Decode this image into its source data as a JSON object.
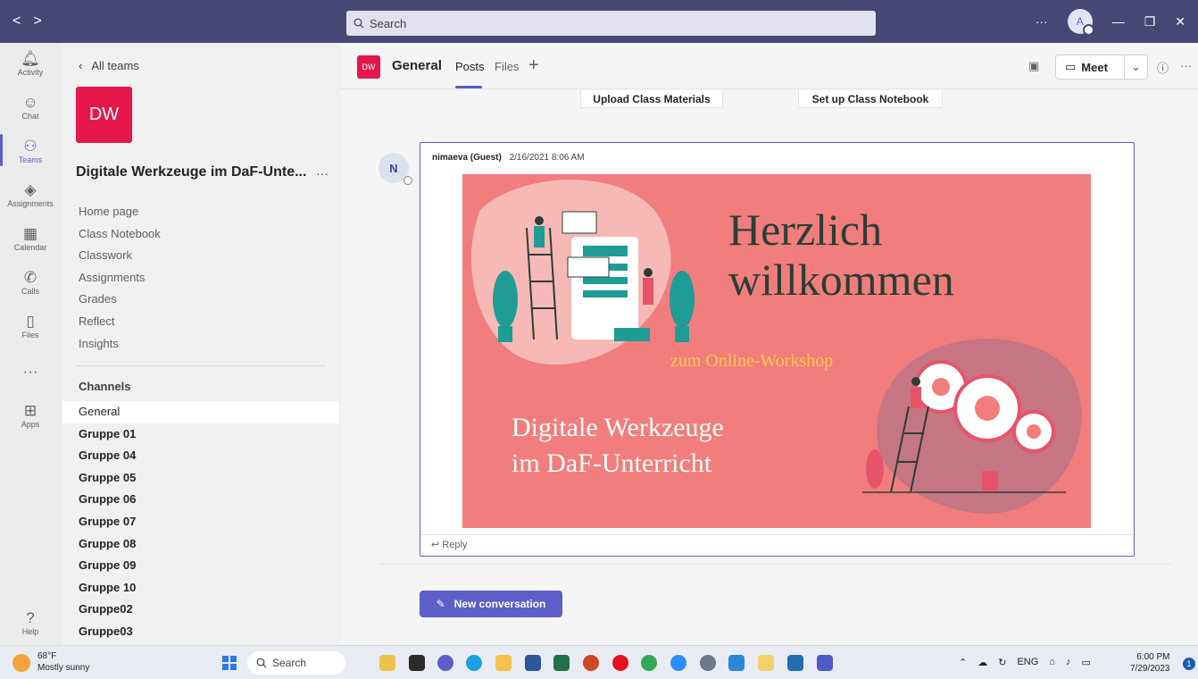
{
  "titlebar": {
    "back": "<",
    "forward": ">",
    "search_placeholder": "Search",
    "more": "···",
    "avatar_initials": "A",
    "min": "—",
    "max": "❐",
    "close": "✕"
  },
  "rail": [
    {
      "label": "Activity",
      "icon": "bell-icon",
      "glyph": "🔔︎"
    },
    {
      "label": "Chat",
      "icon": "chat-icon",
      "glyph": "☺"
    },
    {
      "label": "Teams",
      "icon": "teams-icon",
      "glyph": "⚇"
    },
    {
      "label": "Assignments",
      "icon": "assignments-icon",
      "glyph": "◈"
    },
    {
      "label": "Calendar",
      "icon": "calendar-icon",
      "glyph": "▦"
    },
    {
      "label": "Calls",
      "icon": "phone-icon",
      "glyph": "✆"
    },
    {
      "label": "Files",
      "icon": "file-icon",
      "glyph": "▯"
    },
    {
      "label": "",
      "icon": "more-icon",
      "glyph": "···"
    },
    {
      "label": "Apps",
      "icon": "apps-icon",
      "glyph": "⊞"
    },
    {
      "label": "Help",
      "icon": "help-icon",
      "glyph": "?"
    }
  ],
  "teampanel": {
    "back_label": "All teams",
    "logo_text": "DW",
    "team_name": "Digitale Werkzeuge im DaF-Unte...",
    "more": "···",
    "nav": [
      "Home page",
      "Class Notebook",
      "Classwork",
      "Assignments",
      "Grades",
      "Reflect",
      "Insights"
    ],
    "channels_heading": "Channels",
    "channels": [
      "General",
      "Gruppe 01",
      "Gruppe 04",
      "Gruppe 05",
      "Gruppe 06",
      "Gruppe 07",
      "Gruppe 08",
      "Gruppe 09",
      "Gruppe 10",
      "Gruppe02",
      "Gruppe03"
    ]
  },
  "channel_header": {
    "logo_text": "DW",
    "title": "General",
    "tabs": [
      "Posts",
      "Files"
    ],
    "add_tab": "+",
    "meet_label": "Meet",
    "info": "ⓘ",
    "more": "···"
  },
  "feed": {
    "top_buttons": [
      "Upload Class Materials",
      "Set up Class Notebook"
    ],
    "post": {
      "avatar": "N",
      "author": "nimaeva (Guest)",
      "timestamp": "2/16/2021 8:06 AM",
      "banner_title_line1": "Herzlich",
      "banner_title_line2": "willkommen",
      "banner_sub": "zum Online-Workshop",
      "banner_main_line1": "Digitale Werkzeuge",
      "banner_main_line2": "im DaF-Unterricht",
      "reply": "Reply"
    },
    "new_conversation": "New conversation"
  },
  "taskbar": {
    "temp": "68°F",
    "weather": "Mostly sunny",
    "search": "Search",
    "lang": "ENG",
    "time": "6:00 PM",
    "date": "7/29/2023",
    "notif_count": "1"
  },
  "colors": {
    "brand": "#464775",
    "accent": "#5b5fc7",
    "team_logo": "#e4164a",
    "banner_bg": "#f17e7c"
  }
}
